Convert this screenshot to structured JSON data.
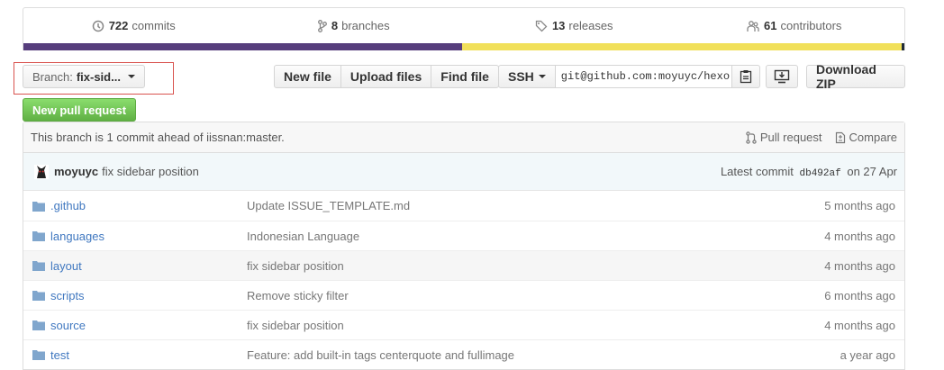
{
  "stats": {
    "commits": {
      "count": "722",
      "label": "commits"
    },
    "branches": {
      "count": "8",
      "label": "branches"
    },
    "releases": {
      "count": "13",
      "label": "releases"
    },
    "contributors": {
      "count": "61",
      "label": "contributors"
    }
  },
  "colors": {
    "lang_purple": "#563d7c",
    "lang_yellow": "#f1e05a",
    "lang_dark": "#222c37",
    "highlight_box": "#d9534f"
  },
  "toolbar": {
    "branch_label": "Branch:",
    "branch_name": "fix-sid...",
    "new_file": "New file",
    "upload_files": "Upload files",
    "find_file": "Find file",
    "protocol": "SSH",
    "clone_url": "git@github.com:moyuyc/hexo",
    "download_zip": "Download ZIP"
  },
  "new_pull_request": "New pull request",
  "branch_status": {
    "text": "This branch is 1 commit ahead of iissnan:master.",
    "pull_request": "Pull request",
    "compare": "Compare"
  },
  "latest_commit": {
    "author": "moyuyc",
    "message": "fix sidebar position",
    "prefix": "Latest commit",
    "sha": "db492af",
    "date": "on 27 Apr"
  },
  "files": [
    {
      "name": ".github",
      "message": "Update ISSUE_TEMPLATE.md",
      "age": "5 months ago"
    },
    {
      "name": "languages",
      "message": "Indonesian Language",
      "age": "4 months ago"
    },
    {
      "name": "layout",
      "message": "fix sidebar position",
      "age": "4 months ago"
    },
    {
      "name": "scripts",
      "message": "Remove sticky filter",
      "age": "6 months ago"
    },
    {
      "name": "source",
      "message": "fix sidebar position",
      "age": "4 months ago"
    },
    {
      "name": "test",
      "message": "Feature: add built-in tags centerquote and fullimage",
      "age": "a year ago"
    }
  ]
}
